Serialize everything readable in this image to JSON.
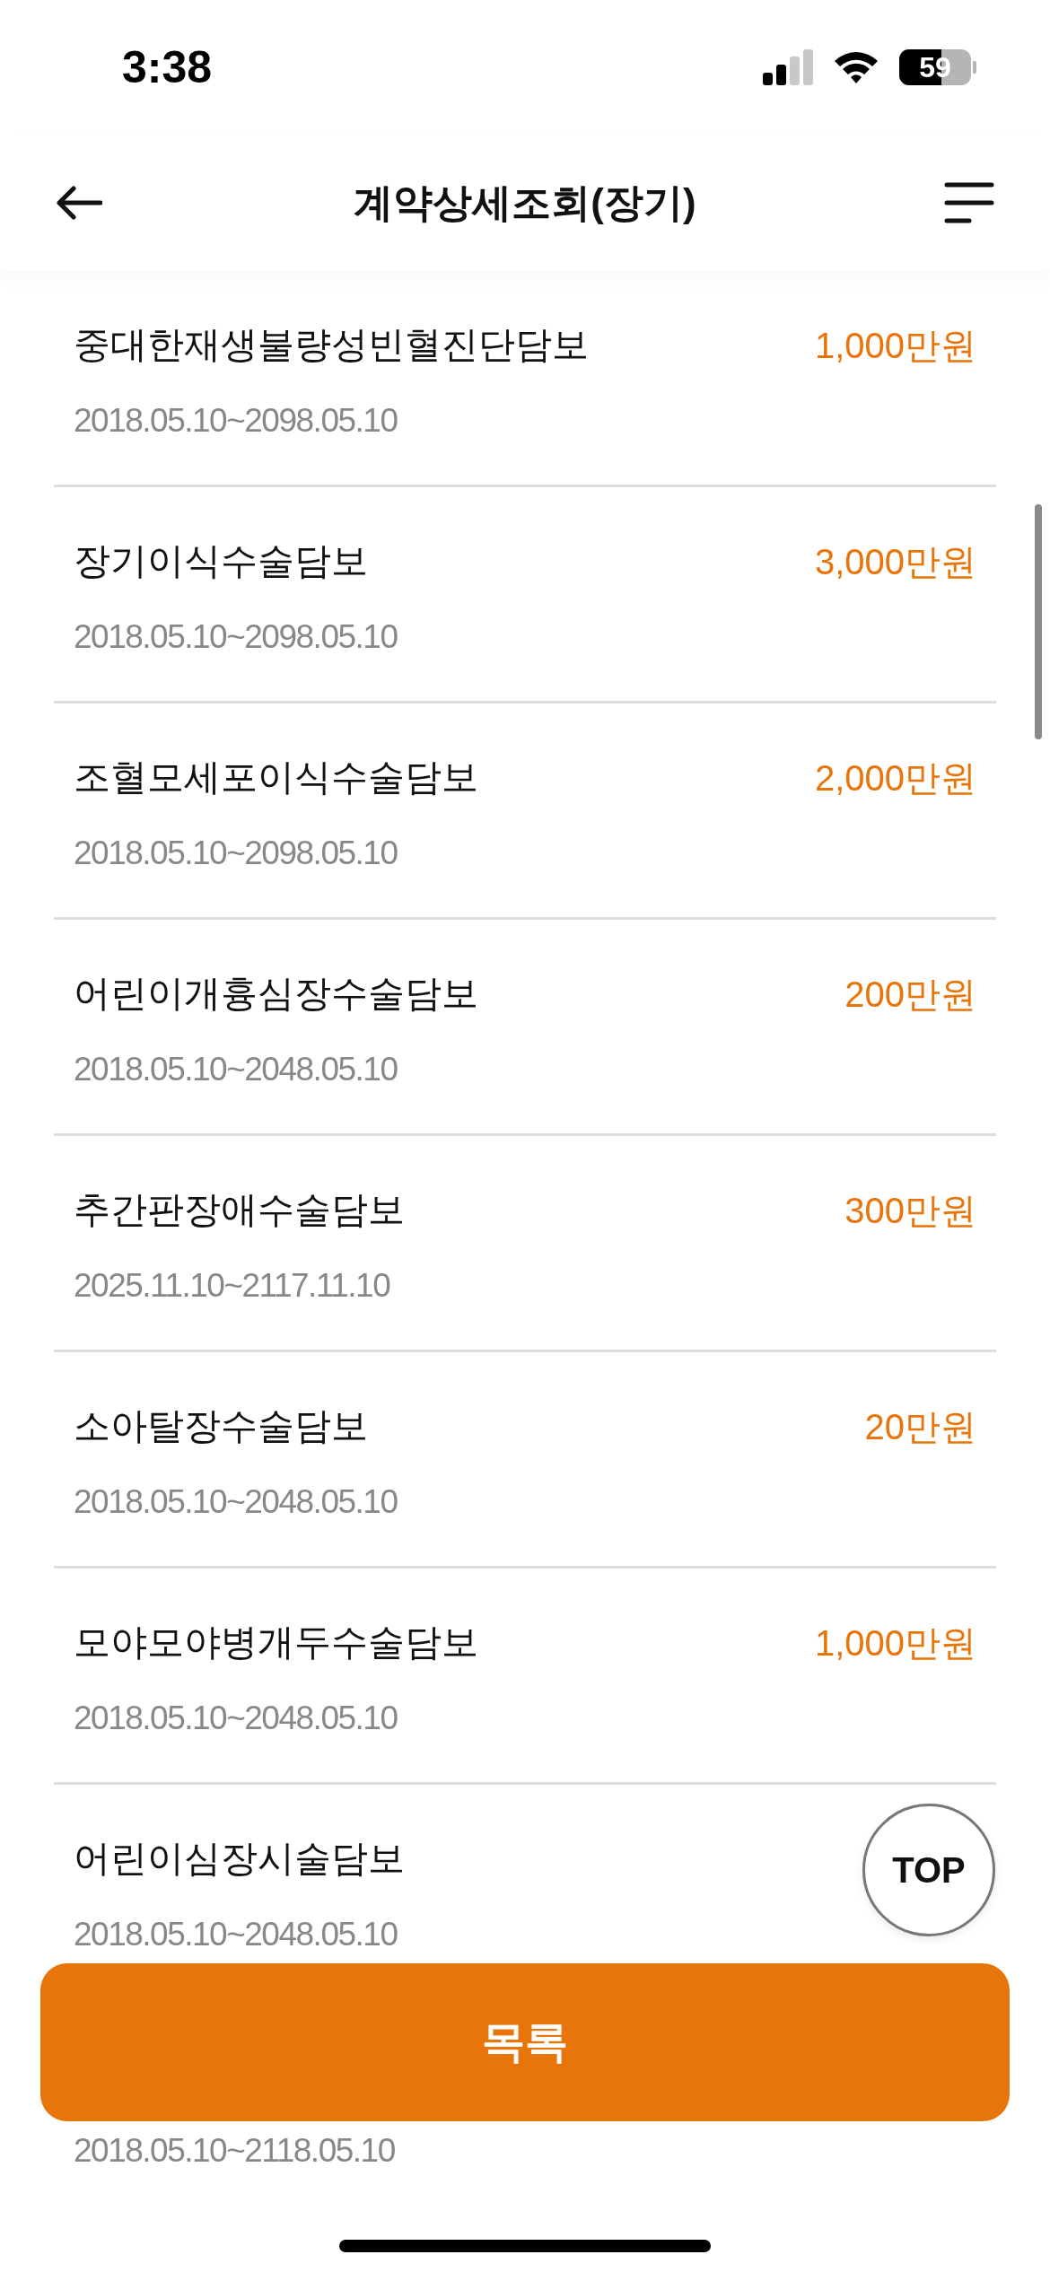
{
  "status_bar": {
    "time": "3:38",
    "battery": "59"
  },
  "header": {
    "title": "계약상세조회(장기)"
  },
  "coverages": [
    {
      "name": "중대한재생불량성빈혈진단담보",
      "period": "2018.05.10~2098.05.10",
      "amount": "1,000만원"
    },
    {
      "name": "장기이식수술담보",
      "period": "2018.05.10~2098.05.10",
      "amount": "3,000만원"
    },
    {
      "name": "조혈모세포이식수술담보",
      "period": "2018.05.10~2098.05.10",
      "amount": "2,000만원"
    },
    {
      "name": "어린이개흉심장수술담보",
      "period": "2018.05.10~2048.05.10",
      "amount": "200만원"
    },
    {
      "name": "추간판장애수술담보",
      "period": "2025.11.10~2117.11.10",
      "amount": "300만원"
    },
    {
      "name": "소아탈장수술담보",
      "period": "2018.05.10~2048.05.10",
      "amount": "20만원"
    },
    {
      "name": "모야모야병개두수술담보",
      "period": "2018.05.10~2048.05.10",
      "amount": "1,000만원"
    },
    {
      "name": "어린이심장시술담보",
      "period": "2018.05.10~2048.05.10"
    },
    {
      "period": "2018.05.10~2118.05.10"
    }
  ],
  "top_button": "TOP",
  "list_button": "목록"
}
